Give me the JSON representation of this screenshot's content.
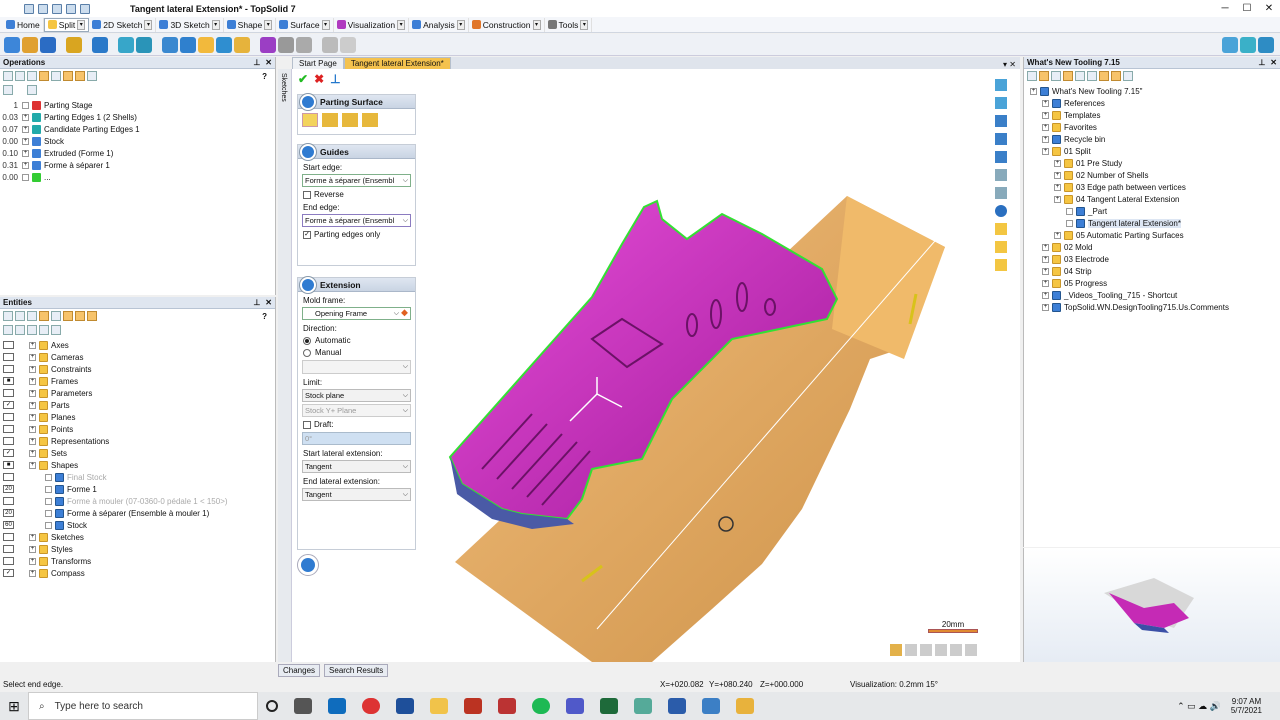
{
  "window": {
    "title": "Tangent lateral Extension* - TopSolid 7",
    "minimize": "─",
    "maximize": "☐",
    "close": "✕"
  },
  "menu": [
    {
      "label": "Home",
      "color": "#3d7fd6"
    },
    {
      "label": "Split",
      "color": "#f5c542",
      "active": true
    },
    {
      "label": "2D Sketch",
      "color": "#3d7fd6"
    },
    {
      "label": "3D Sketch",
      "color": "#3d7fd6"
    },
    {
      "label": "Shape",
      "color": "#3d7fd6"
    },
    {
      "label": "Surface",
      "color": "#3d7fd6"
    },
    {
      "label": "Visualization",
      "color": "#b03ac0"
    },
    {
      "label": "Analysis",
      "color": "#3d7fd6"
    },
    {
      "label": "Construction",
      "color": "#e0762a"
    },
    {
      "label": "Tools",
      "color": "#777"
    }
  ],
  "operations": {
    "title": "Operations",
    "rows": [
      {
        "num": "1",
        "label": "Parting Stage",
        "icon": "red-arrow-icon",
        "color": "#d33"
      },
      {
        "num": "0.03",
        "label": "Parting Edges 1 (2 Shells)",
        "icon": "parting-edges-icon",
        "color": "#2aa"
      },
      {
        "num": "0.07",
        "label": "Candidate Parting Edges 1",
        "icon": "candidate-edges-icon",
        "color": "#2aa"
      },
      {
        "num": "0.00",
        "label": "Stock",
        "icon": "stock-icon",
        "color": "#3d7fd6"
      },
      {
        "num": "0.10",
        "label": "Extruded (Forme 1)",
        "icon": "extruded-icon",
        "color": "#3d7fd6"
      },
      {
        "num": "0.31",
        "label": "Forme à séparer 1",
        "icon": "shape-icon",
        "color": "#3d7fd6"
      },
      {
        "num": "0.00",
        "label": "...",
        "icon": "green-arrow-icon",
        "color": "#3c3"
      }
    ]
  },
  "entities": {
    "title": "Entities",
    "rows": [
      {
        "label": "Axes",
        "check": "",
        "grey": false,
        "indent": 0
      },
      {
        "label": "Cameras",
        "check": "",
        "grey": false,
        "indent": 0
      },
      {
        "label": "Constraints",
        "check": "",
        "grey": false,
        "indent": 0
      },
      {
        "label": "Frames",
        "check": "■",
        "grey": false,
        "indent": 0
      },
      {
        "label": "Parameters",
        "check": "",
        "grey": false,
        "indent": 0
      },
      {
        "label": "Parts",
        "check": "✓",
        "grey": false,
        "indent": 0
      },
      {
        "label": "Planes",
        "check": "",
        "grey": false,
        "indent": 0
      },
      {
        "label": "Points",
        "check": "",
        "grey": false,
        "indent": 0
      },
      {
        "label": "Representations",
        "check": "",
        "grey": false,
        "indent": 0
      },
      {
        "label": "Sets",
        "check": "✓",
        "grey": false,
        "indent": 0
      },
      {
        "label": "Shapes",
        "check": "■",
        "grey": false,
        "indent": 0
      },
      {
        "label": "Final Stock",
        "check": "",
        "grey": true,
        "indent": 1
      },
      {
        "label": "Forme 1",
        "check": "20",
        "grey": false,
        "indent": 1
      },
      {
        "label": "Forme à mouler (07-0360-0 pédale 1 < 150>)",
        "check": "",
        "grey": true,
        "indent": 1
      },
      {
        "label": "Forme à séparer (Ensemble à mouler 1)",
        "check": "20",
        "grey": false,
        "indent": 1
      },
      {
        "label": "Stock",
        "check": "60",
        "grey": false,
        "indent": 1
      },
      {
        "label": "Sketches",
        "check": "",
        "grey": false,
        "indent": 0
      },
      {
        "label": "Styles",
        "check": "",
        "grey": false,
        "indent": 0
      },
      {
        "label": "Transforms",
        "check": "",
        "grey": false,
        "indent": 0
      },
      {
        "label": "Compass",
        "check": "✓",
        "grey": false,
        "indent": 0
      }
    ]
  },
  "bottom_tabs": {
    "changes": "Changes",
    "search": "Search Results"
  },
  "doc_tabs": {
    "start": "Start Page",
    "active": "Tangent lateral Extension*"
  },
  "sidestrip_label": "Sketches",
  "props": {
    "parting_surface": "Parting Surface",
    "guides": "Guides",
    "start_edge_label": "Start edge:",
    "start_edge_value": "Forme à séparer (Ensembl",
    "reverse": "Reverse",
    "end_edge_label": "End edge:",
    "end_edge_value": "Forme à séparer (Ensembl",
    "parting_edges_only": "Parting edges only",
    "extension": "Extension",
    "mold_frame_label": "Mold frame:",
    "mold_frame_value": "Opening Frame",
    "direction_label": "Direction:",
    "automatic": "Automatic",
    "manual": "Manual",
    "limit_label": "Limit:",
    "limit_value": "Stock plane",
    "stock_plane_value": "Stock Y+ Plane",
    "draft": "Draft:",
    "draft_value": "0°",
    "start_lateral_label": "Start lateral extension:",
    "start_lateral_value": "Tangent",
    "end_lateral_label": "End lateral extension:",
    "end_lateral_value": "Tangent"
  },
  "scale_label": "20mm",
  "project": {
    "title": "What's New Tooling 7.15",
    "rows": [
      {
        "label": "What's New Tooling 7.15\"",
        "indent": 0,
        "icon": "project-icon"
      },
      {
        "label": "References",
        "indent": 1,
        "icon": "references-icon"
      },
      {
        "label": "Templates",
        "indent": 1,
        "icon": "folder-icon"
      },
      {
        "label": "Favorites",
        "indent": 1,
        "icon": "folder-icon"
      },
      {
        "label": "Recycle bin",
        "indent": 1,
        "icon": "recycle-bin-icon"
      },
      {
        "label": "01 Split",
        "indent": 1,
        "icon": "folder-icon"
      },
      {
        "label": "01 Pre Study",
        "indent": 2,
        "icon": "folder-icon"
      },
      {
        "label": "02 Number of Shells",
        "indent": 2,
        "icon": "folder-icon"
      },
      {
        "label": "03 Edge path between vertices",
        "indent": 2,
        "icon": "folder-icon"
      },
      {
        "label": "04 Tangent Lateral Extension",
        "indent": 2,
        "icon": "folder-icon"
      },
      {
        "label": "_Part",
        "indent": 3,
        "icon": "part-icon"
      },
      {
        "label": "Tangent lateral Extension*",
        "indent": 3,
        "icon": "document-icon",
        "active": true
      },
      {
        "label": "05 Automatic Parting Surfaces",
        "indent": 2,
        "icon": "folder-icon"
      },
      {
        "label": "02 Mold",
        "indent": 1,
        "icon": "folder-icon"
      },
      {
        "label": "03 Electrode",
        "indent": 1,
        "icon": "folder-icon"
      },
      {
        "label": "04 Strip",
        "indent": 1,
        "icon": "folder-icon"
      },
      {
        "label": "05 Progress",
        "indent": 1,
        "icon": "folder-icon"
      },
      {
        "label": "_Videos_Tooling_715 - Shortcut",
        "indent": 1,
        "icon": "shortcut-icon"
      },
      {
        "label": "TopSolid.WN.DesignTooling715.Us.Comments",
        "indent": 1,
        "icon": "comments-icon"
      }
    ]
  },
  "status": {
    "prompt": "Select end edge.",
    "x": "X=+020.082",
    "y": "Y=+080.240",
    "z": "Z=+000.000",
    "visualization": "Visualization: 0.2mm 15°"
  },
  "taskbar": {
    "search": "Type here to search",
    "time": "9:07 AM",
    "date": "5/7/2021"
  }
}
